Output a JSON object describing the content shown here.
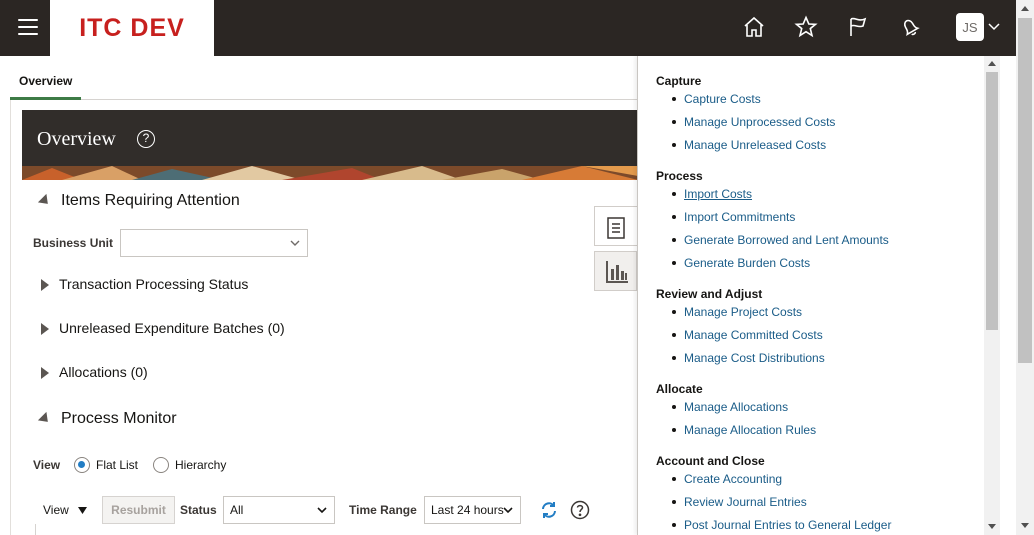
{
  "header": {
    "brand": "ITC DEV",
    "avatar_initials": "JS",
    "icons": [
      "home-icon",
      "favorites-star-icon",
      "flag-icon",
      "notifications-bell-icon"
    ]
  },
  "tabs": [
    {
      "label": "Overview",
      "active": true
    }
  ],
  "banner": {
    "title": "Overview"
  },
  "items_requiring_attention": {
    "heading": "Items Requiring Attention",
    "business_unit_label": "Business Unit",
    "business_unit_value": "",
    "rows": [
      {
        "label": "Transaction Processing Status"
      },
      {
        "label": "Unreleased Expenditure Batches (0)"
      },
      {
        "label": "Allocations (0)"
      }
    ]
  },
  "process_monitor": {
    "heading": "Process Monitor",
    "view_label": "View",
    "view_options": [
      "Flat List",
      "Hierarchy"
    ],
    "view_selected": "Flat List",
    "toolbar": {
      "view_menu": "View",
      "resubmit": "Resubmit",
      "status_label": "Status",
      "status_value": "All",
      "time_range_label": "Time Range",
      "time_range_value": "Last 24 hours"
    }
  },
  "tasks": [
    {
      "heading": "Capture",
      "links": [
        "Capture Costs",
        "Manage Unprocessed Costs",
        "Manage Unreleased Costs"
      ]
    },
    {
      "heading": "Process",
      "links": [
        "Import Costs",
        "Import Commitments",
        "Generate Borrowed and Lent Amounts",
        "Generate Burden Costs"
      ]
    },
    {
      "heading": "Review and Adjust",
      "links": [
        "Manage Project Costs",
        "Manage Committed Costs",
        "Manage Cost Distributions"
      ]
    },
    {
      "heading": "Allocate",
      "links": [
        "Manage Allocations",
        "Manage Allocation Rules"
      ]
    },
    {
      "heading": "Account and Close",
      "links": [
        "Create Accounting",
        "Review Journal Entries",
        "Post Journal Entries to General Ledger"
      ]
    }
  ],
  "colors": {
    "header_bg": "#2b2623",
    "brand_red": "#c7201e",
    "link": "#1a5c88",
    "tab_accent": "#3d7b46",
    "radio_blue": "#227dc4"
  }
}
